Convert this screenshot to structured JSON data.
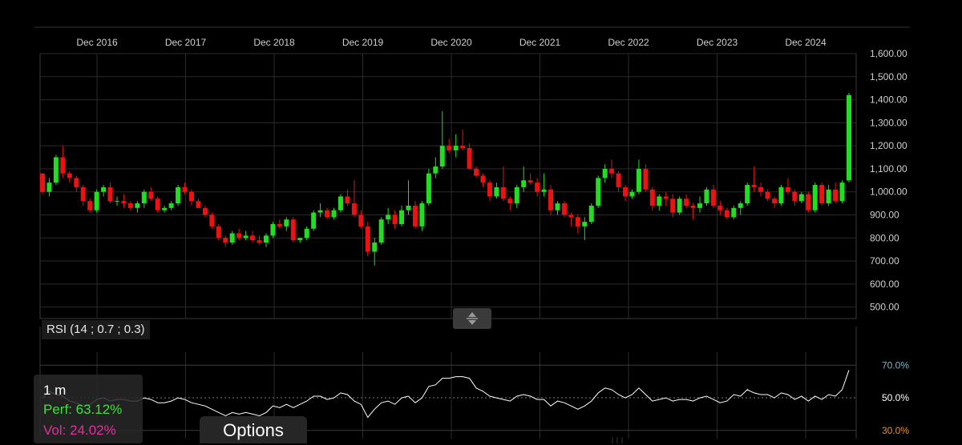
{
  "chart_data": [
    {
      "type": "candlestick",
      "x_labels": [
        "Dec 2016",
        "Dec 2017",
        "Dec 2018",
        "Dec 2019",
        "Dec 2020",
        "Dec 2021",
        "Dec 2022",
        "Dec 2023",
        "Dec 2024"
      ],
      "y_ticks": [
        "1,600.00",
        "1,500.00",
        "1,400.00",
        "1,300.00",
        "1,200.00",
        "1,100.00",
        "1,000.00",
        "900.00",
        "800.00",
        "700.00",
        "600.00",
        "500.00"
      ],
      "ylim": [
        450,
        1600
      ],
      "up_color": "#22dd22",
      "down_color": "#ee1111",
      "grid": true,
      "candles": [
        [
          1080,
          1080,
          990,
          1000
        ],
        [
          1000,
          1060,
          980,
          1040
        ],
        [
          1040,
          1160,
          1030,
          1150
        ],
        [
          1150,
          1200,
          1060,
          1080
        ],
        [
          1080,
          1090,
          1040,
          1060
        ],
        [
          1060,
          1070,
          1000,
          1020
        ],
        [
          1020,
          1030,
          940,
          960
        ],
        [
          960,
          970,
          910,
          920
        ],
        [
          920,
          1010,
          910,
          1000
        ],
        [
          1000,
          1030,
          980,
          1020
        ],
        [
          1020,
          1040,
          950,
          960
        ],
        [
          960,
          980,
          940,
          960
        ],
        [
          960,
          990,
          930,
          950
        ],
        [
          950,
          960,
          920,
          930
        ],
        [
          930,
          960,
          910,
          950
        ],
        [
          950,
          1010,
          930,
          1000
        ],
        [
          1000,
          1020,
          960,
          970
        ],
        [
          970,
          980,
          910,
          920
        ],
        [
          920,
          940,
          910,
          930
        ],
        [
          930,
          960,
          920,
          950
        ],
        [
          950,
          1030,
          940,
          1020
        ],
        [
          1020,
          1040,
          990,
          1000
        ],
        [
          1000,
          1010,
          940,
          960
        ],
        [
          960,
          970,
          930,
          930
        ],
        [
          930,
          940,
          890,
          900
        ],
        [
          900,
          910,
          840,
          850
        ],
        [
          850,
          860,
          790,
          800
        ],
        [
          800,
          810,
          760,
          780
        ],
        [
          780,
          830,
          770,
          820
        ],
        [
          820,
          840,
          790,
          800
        ],
        [
          800,
          830,
          790,
          810
        ],
        [
          810,
          830,
          780,
          790
        ],
        [
          790,
          810,
          770,
          780
        ],
        [
          780,
          820,
          760,
          810
        ],
        [
          810,
          870,
          800,
          860
        ],
        [
          860,
          880,
          840,
          850
        ],
        [
          850,
          890,
          830,
          880
        ],
        [
          880,
          890,
          780,
          790
        ],
        [
          790,
          800,
          780,
          800
        ],
        [
          800,
          850,
          790,
          840
        ],
        [
          840,
          920,
          830,
          910
        ],
        [
          910,
          950,
          890,
          920
        ],
        [
          920,
          930,
          880,
          890
        ],
        [
          890,
          930,
          880,
          920
        ],
        [
          920,
          990,
          910,
          980
        ],
        [
          980,
          1010,
          940,
          950
        ],
        [
          950,
          1050,
          890,
          900
        ],
        [
          900,
          920,
          840,
          850
        ],
        [
          850,
          870,
          720,
          740
        ],
        [
          740,
          800,
          680,
          780
        ],
        [
          780,
          890,
          770,
          880
        ],
        [
          880,
          930,
          860,
          900
        ],
        [
          900,
          920,
          840,
          860
        ],
        [
          860,
          940,
          850,
          920
        ],
        [
          920,
          1050,
          900,
          940
        ],
        [
          940,
          960,
          840,
          850
        ],
        [
          850,
          960,
          830,
          950
        ],
        [
          950,
          1100,
          940,
          1080
        ],
        [
          1080,
          1150,
          1060,
          1110
        ],
        [
          1110,
          1350,
          1100,
          1200
        ],
        [
          1200,
          1230,
          1170,
          1180
        ],
        [
          1180,
          1250,
          1150,
          1200
        ],
        [
          1200,
          1270,
          1180,
          1190
        ],
        [
          1190,
          1210,
          1120,
          1100
        ],
        [
          1100,
          1110,
          1060,
          1070
        ],
        [
          1070,
          1080,
          1020,
          1040
        ],
        [
          1040,
          1050,
          960,
          980
        ],
        [
          980,
          1040,
          970,
          1020
        ],
        [
          1020,
          1110,
          960,
          970
        ],
        [
          970,
          980,
          920,
          950
        ],
        [
          950,
          1030,
          930,
          1020
        ],
        [
          1020,
          1110,
          1000,
          1050
        ],
        [
          1050,
          1080,
          1030,
          1040
        ],
        [
          1040,
          1060,
          980,
          1000
        ],
        [
          1000,
          1080,
          980,
          1010
        ],
        [
          1010,
          1030,
          900,
          920
        ],
        [
          920,
          960,
          900,
          950
        ],
        [
          950,
          960,
          890,
          900
        ],
        [
          900,
          910,
          850,
          890
        ],
        [
          890,
          900,
          820,
          850
        ],
        [
          850,
          890,
          790,
          870
        ],
        [
          870,
          950,
          860,
          940
        ],
        [
          940,
          1070,
          930,
          1060
        ],
        [
          1060,
          1120,
          1040,
          1100
        ],
        [
          1100,
          1140,
          1060,
          1080
        ],
        [
          1080,
          1090,
          1000,
          1020
        ],
        [
          1020,
          1030,
          960,
          980
        ],
        [
          980,
          1010,
          970,
          1000
        ],
        [
          1000,
          1140,
          990,
          1100
        ],
        [
          1100,
          1120,
          1000,
          1010
        ],
        [
          1010,
          1020,
          920,
          940
        ],
        [
          940,
          990,
          920,
          980
        ],
        [
          980,
          1000,
          940,
          970
        ],
        [
          970,
          990,
          890,
          910
        ],
        [
          910,
          980,
          900,
          970
        ],
        [
          970,
          990,
          930,
          940
        ],
        [
          940,
          950,
          880,
          930
        ],
        [
          930,
          980,
          910,
          950
        ],
        [
          950,
          1020,
          940,
          1010
        ],
        [
          1010,
          1030,
          930,
          940
        ],
        [
          940,
          960,
          900,
          920
        ],
        [
          920,
          930,
          880,
          890
        ],
        [
          890,
          940,
          880,
          930
        ],
        [
          930,
          960,
          900,
          950
        ],
        [
          950,
          1040,
          940,
          1030
        ],
        [
          1030,
          1110,
          1000,
          1020
        ],
        [
          1020,
          1040,
          980,
          1000
        ],
        [
          1000,
          1010,
          960,
          970
        ],
        [
          970,
          980,
          930,
          950
        ],
        [
          950,
          1030,
          940,
          1020
        ],
        [
          1020,
          1060,
          990,
          1000
        ],
        [
          1000,
          1010,
          940,
          960
        ],
        [
          960,
          1000,
          950,
          990
        ],
        [
          990,
          1000,
          910,
          920
        ],
        [
          920,
          1040,
          910,
          1030
        ],
        [
          1030,
          1040,
          940,
          950
        ],
        [
          950,
          1030,
          940,
          1010
        ],
        [
          1010,
          1040,
          950,
          960
        ],
        [
          960,
          1050,
          950,
          1040
        ],
        [
          1050,
          1430,
          1040,
          1420
        ]
      ]
    },
    {
      "type": "line",
      "title": "RSI (14 ; 0.7 ; 0.3)",
      "y_ticks": [
        {
          "label": "70.0%",
          "value": 70,
          "color": "#7ab4c8"
        },
        {
          "label": "50.0%",
          "value": 50,
          "color": "#ffffff"
        },
        {
          "label": "30.0%",
          "value": 30,
          "color": "#e8922a"
        }
      ],
      "ylim": [
        25,
        78
      ],
      "line_color": "#ffffff",
      "series": [
        {
          "values": [
            50,
            54,
            52,
            51,
            48,
            47,
            45,
            46,
            49,
            50,
            48,
            49,
            49,
            48,
            48,
            50,
            49,
            47,
            47,
            48,
            50,
            49,
            47,
            46,
            45,
            43,
            41,
            39,
            41,
            40,
            41,
            40,
            39,
            41,
            45,
            44,
            46,
            44,
            46,
            48,
            51,
            51,
            49,
            50,
            53,
            52,
            48,
            46,
            38,
            43,
            47,
            48,
            46,
            50,
            51,
            47,
            50,
            57,
            58,
            62,
            62,
            63,
            63,
            62,
            56,
            54,
            51,
            50,
            49,
            48,
            51,
            52,
            51,
            49,
            49,
            45,
            48,
            47,
            45,
            43,
            45,
            48,
            53,
            56,
            55,
            52,
            50,
            52,
            56,
            52,
            48,
            49,
            50,
            48,
            49,
            49,
            48,
            50,
            51,
            49,
            47,
            48,
            52,
            51,
            55,
            53,
            52,
            52,
            50,
            53,
            52,
            49,
            51,
            48,
            51,
            49,
            52,
            51,
            55,
            67
          ]
        }
      ]
    }
  ],
  "rsi_label": "RSI (14 ; 0.7 ; 0.3)",
  "stats": {
    "timeframe": "1 m",
    "perf": "Perf: 63.12%",
    "vol": "Vol: 24.02%"
  },
  "options_label": "Options"
}
